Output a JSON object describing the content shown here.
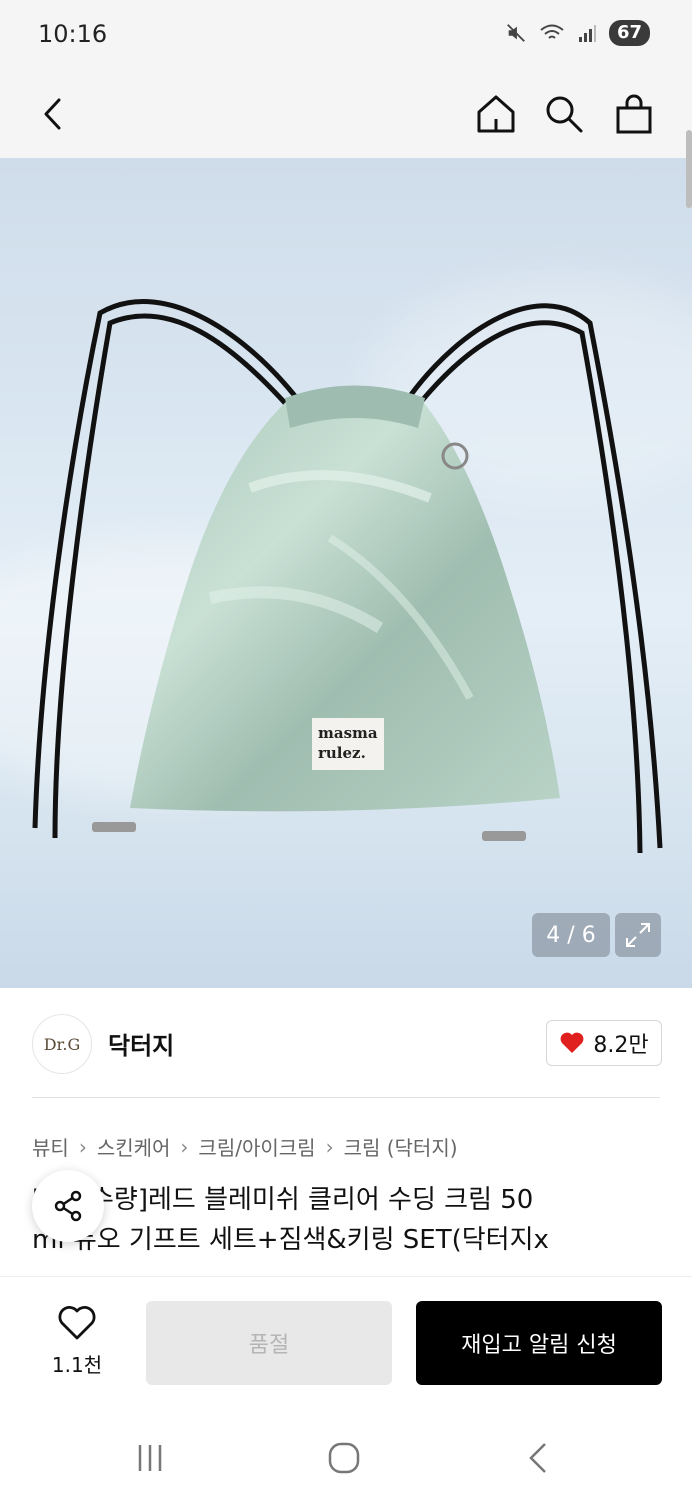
{
  "status_bar": {
    "time": "10:16",
    "battery": "67",
    "icons": [
      "mute-icon",
      "wifi-icon",
      "signal-icon"
    ]
  },
  "header": {
    "back_icon": "back-arrow-icon",
    "home_icon": "home-icon",
    "search_icon": "search-icon",
    "cart_icon": "shopping-bag-icon"
  },
  "gallery": {
    "counter": "4 / 6",
    "expand_icon": "expand-icon",
    "bag_label_line1": "masma",
    "bag_label_line2": "rulez."
  },
  "brand": {
    "logo_text": "Dr.G",
    "name": "닥터지",
    "likes": "8.2만",
    "heart_color": "#e0201f"
  },
  "breadcrumb": [
    "뷰티",
    "스킨케어",
    "크림/아이크림",
    "크림 (닥터지)"
  ],
  "product": {
    "title_line1": "[한정수량]레드 블레미쉬 클리어 수딩 크림 50",
    "title_line2": "ml 듀오 기프트 세트+짐색&키링 SET(닥터지x"
  },
  "bottom_bar": {
    "wish_count": "1.1천",
    "soldout_label": "품절",
    "restock_label": "재입고 알림 신청"
  },
  "nav": {
    "recents_icon": "recents-icon",
    "home_icon": "home-circle-icon",
    "back_icon": "nav-back-icon"
  }
}
